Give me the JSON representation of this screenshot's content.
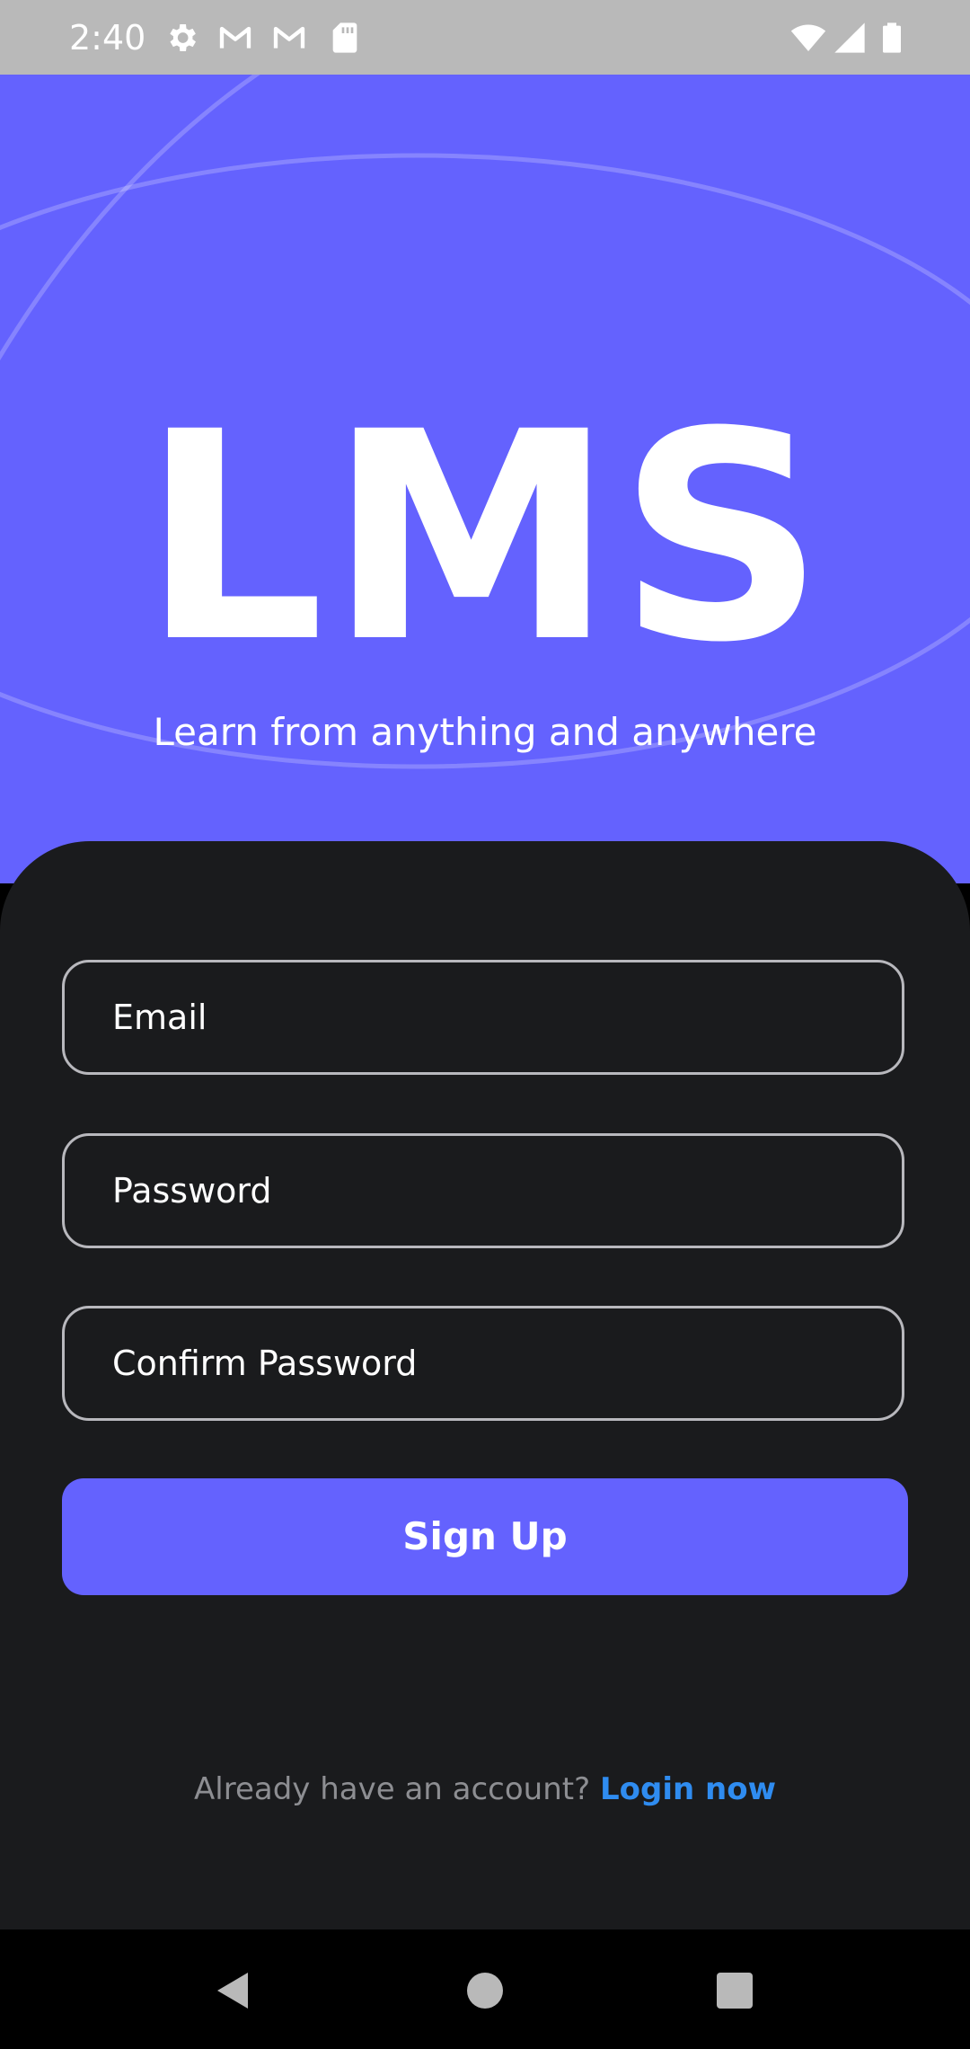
{
  "status_bar": {
    "time": "2:40",
    "left_icons": [
      "gear-icon",
      "gmail-icon",
      "gmail-icon",
      "sd-card-icon"
    ],
    "right_icons": [
      "wifi-icon",
      "signal-icon",
      "battery-icon"
    ]
  },
  "header": {
    "logo": "LMS",
    "tagline": "Learn from anything and anywhere",
    "background_color": "#6462fe"
  },
  "form": {
    "email_placeholder": "Email",
    "password_placeholder": "Password",
    "confirm_password_placeholder": "Confirm Password",
    "signup_label": "Sign Up",
    "login_prompt": "Already have an account?",
    "login_link": "Login now",
    "panel_color": "#1a1b1d",
    "button_color": "#6462fe",
    "link_color": "#2f8cf0"
  },
  "nav_bar": {
    "icons": [
      "back-icon",
      "home-icon",
      "recents-icon"
    ]
  }
}
